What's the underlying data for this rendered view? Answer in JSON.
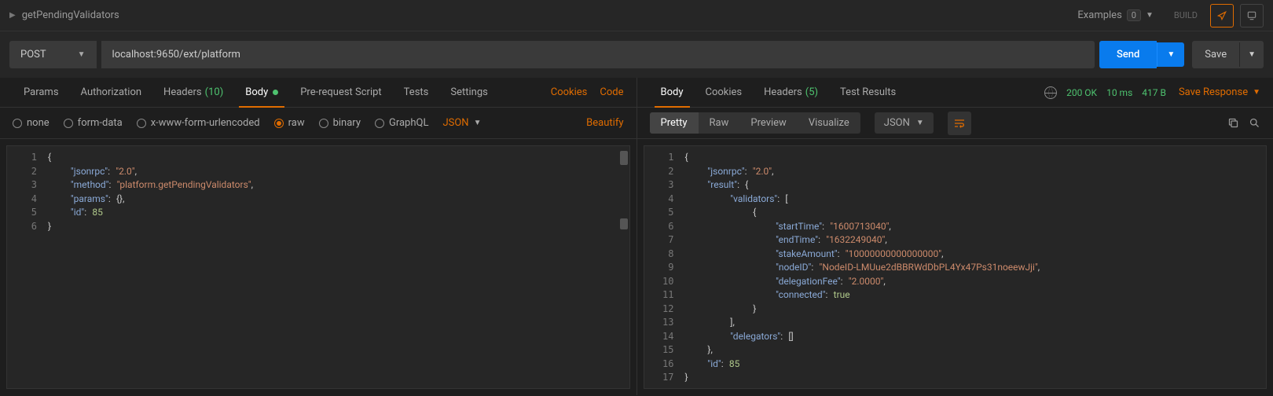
{
  "header": {
    "request_name": "getPendingValidators",
    "examples_label": "Examples",
    "examples_count": "0",
    "build_label": "BUILD"
  },
  "url_bar": {
    "method": "POST",
    "url": "localhost:9650/ext/platform",
    "send_label": "Send",
    "save_label": "Save"
  },
  "request_tabs": {
    "params": "Params",
    "authorization": "Authorization",
    "headers": "Headers",
    "headers_count": "(10)",
    "body": "Body",
    "prerequest": "Pre-request Script",
    "tests": "Tests",
    "settings": "Settings",
    "cookies": "Cookies",
    "code": "Code"
  },
  "body_type_bar": {
    "none": "none",
    "form_data": "form-data",
    "xwww": "x-www-form-urlencoded",
    "raw": "raw",
    "binary": "binary",
    "graphql": "GraphQL",
    "content_type": "JSON",
    "beautify": "Beautify"
  },
  "request_body": {
    "jsonrpc": "2.0",
    "method": "platform.getPendingValidators",
    "params": {},
    "id": 85
  },
  "response_tabs": {
    "body": "Body",
    "cookies": "Cookies",
    "headers": "Headers",
    "headers_count": "(5)",
    "test_results": "Test Results"
  },
  "response_status": {
    "code": "200 OK",
    "time": "10 ms",
    "size": "417 B",
    "save_response": "Save Response"
  },
  "response_view": {
    "pretty": "Pretty",
    "raw": "Raw",
    "preview": "Preview",
    "visualize": "Visualize",
    "format": "JSON"
  },
  "response_body": {
    "jsonrpc": "2.0",
    "result": {
      "validators": [
        {
          "startTime": "1600713040",
          "endTime": "1632249040",
          "stakeAmount": "10000000000000000",
          "nodeID": "NodeID-LMUue2dBBRWdDbPL4Yx47Ps31noeewJji",
          "delegationFee": "2.0000",
          "connected": true
        }
      ],
      "delegators": []
    },
    "id": 85
  }
}
